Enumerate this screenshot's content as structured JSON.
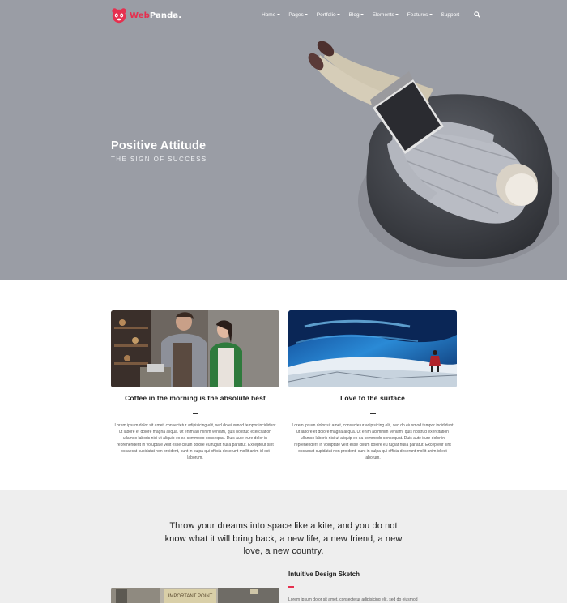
{
  "brand": {
    "name_web": "Web",
    "name_panda": "Panda.",
    "accent": "#e5304f"
  },
  "nav": {
    "items": [
      {
        "label": "Home"
      },
      {
        "label": "Pages"
      },
      {
        "label": "Portfolio"
      },
      {
        "label": "Blog"
      },
      {
        "label": "Elements"
      },
      {
        "label": "Features"
      }
    ],
    "support": "Support"
  },
  "hero": {
    "title": "Positive Attitude",
    "subtitle": "THE SIGN OF SUCCESS"
  },
  "cards": [
    {
      "title": "Coffee in the morning is the absolute best",
      "text": "Lorem ipsum dolor sit amet, consectetur adipisicing elit, sed do eiusmod tempor incididunt ut labore et dolore magna aliqua. Ut enim ad minim veniam, quis nostrud exercitation ullamco laboris nisi ut aliquip ex ea commodo consequat. Duis aute irure dolor in reprehenderit in voluptate velit esse cillum dolore eu fugiat nulla pariatur. Excepteur sint occaecat cupidatat non proident, sunt in culpa qui officia deserunt mollit anim id est laborum."
    },
    {
      "title": "Love to the surface",
      "text": "Lorem ipsum dolor sit amet, consectetur adipisicing elit, sed do eiusmod tempor incididunt ut labore et dolore magna aliqua. Ut enim ad minim veniam, quis nostrud exercitation ullamco laboris nisi ut aliquip ex ea commodo consequat. Duis aute irure dolor in reprehenderit in voluptate velit esse cillum dolore eu fugiat nulla pariatur. Excepteur sint occaecat cupidatat non proident, sunt in culpa qui officia deserunt mollit anim id est laborum."
    }
  ],
  "quote": "Throw your dreams into space like a kite, and you do not know what it will bring back, a new life, a new friend, a new love, a new country.",
  "sketch": {
    "title": "Intuitive Design Sketch",
    "text": "Lorem ipsum dolor sit amet, consectetur adipisicing elit, sed do eiusmod",
    "image_sign": "IMPORTANT POINT"
  }
}
